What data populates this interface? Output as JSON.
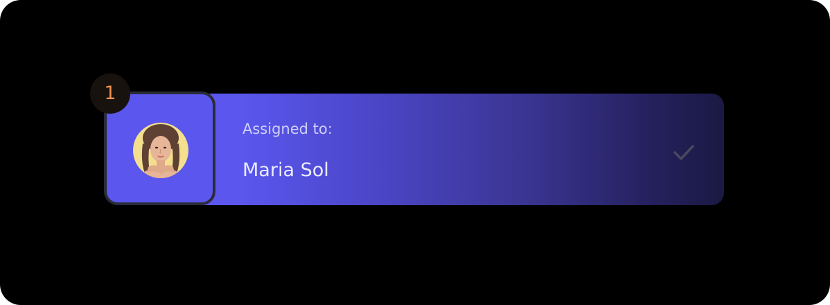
{
  "step": {
    "number": "1"
  },
  "assignment": {
    "label": "Assigned to:",
    "assignee_name": "Maria Sol",
    "avatar_icon": "user-avatar-photo",
    "status_icon": "check-icon"
  },
  "colors": {
    "card_gradient_start": "#5a56ee",
    "card_gradient_end": "#1b1943",
    "badge_background": "#17120e",
    "badge_text": "#f0904f",
    "check": "#4a4860"
  }
}
